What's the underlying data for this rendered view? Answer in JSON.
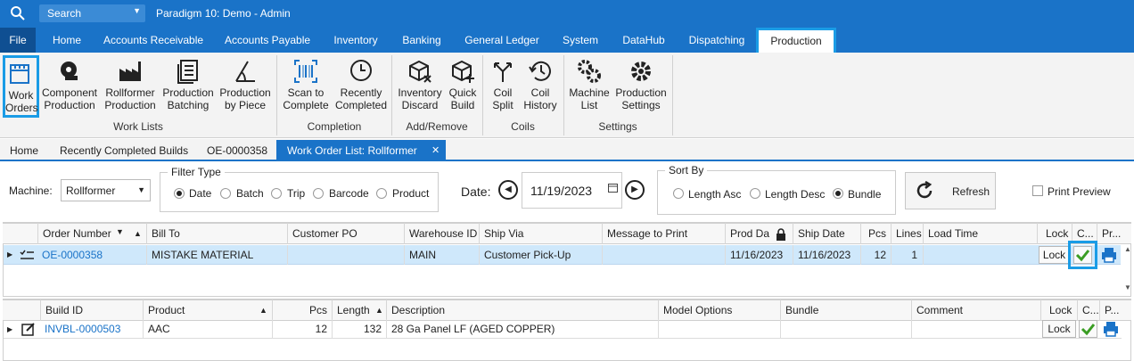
{
  "titlebar": {
    "search_placeholder": "Search",
    "app_title": "Paradigm 10: Demo - Admin"
  },
  "menu": {
    "file": "File",
    "home": "Home",
    "accounts_receivable": "Accounts Receivable",
    "accounts_payable": "Accounts Payable",
    "inventory": "Inventory",
    "banking": "Banking",
    "general_ledger": "General Ledger",
    "system": "System",
    "datahub": "DataHub",
    "dispatching": "Dispatching",
    "production": "Production"
  },
  "ribbon": {
    "work_orders": [
      "Work",
      "Orders"
    ],
    "component_production": [
      "Component",
      "Production"
    ],
    "rollformer_production": [
      "Rollformer",
      "Production"
    ],
    "production_batching": [
      "Production",
      "Batching"
    ],
    "production_by_piece": [
      "Production",
      "by Piece"
    ],
    "scan_to_complete": [
      "Scan to",
      "Complete"
    ],
    "recently_completed": [
      "Recently",
      "Completed"
    ],
    "inventory_discard": [
      "Inventory",
      "Discard"
    ],
    "quick_build": [
      "Quick",
      "Build"
    ],
    "coil_split": [
      "Coil",
      "Split"
    ],
    "coil_history": [
      "Coil",
      "History"
    ],
    "machine_list": [
      "Machine",
      "List"
    ],
    "production_settings": [
      "Production",
      "Settings"
    ],
    "groups": {
      "work_lists": "Work Lists",
      "completion": "Completion",
      "add_remove": "Add/Remove",
      "coils": "Coils",
      "settings": "Settings"
    }
  },
  "tabs": {
    "home": "Home",
    "recently_completed_builds": "Recently Completed Builds",
    "order": "OE-0000358",
    "active": "Work Order List: Rollformer",
    "close": "✕"
  },
  "filters": {
    "machine_label": "Machine:",
    "machine_value": "Rollformer",
    "filter_type_label": "Filter Type",
    "filter_types": [
      "Date",
      "Batch",
      "Trip",
      "Barcode",
      "Product"
    ],
    "filter_selected": "Date",
    "date_label": "Date:",
    "date_value": "11/19/2023",
    "sort_by_label": "Sort By",
    "sort_options": [
      "Length Asc",
      "Length Desc",
      "Bundle"
    ],
    "sort_selected": "Bundle",
    "refresh": "Refresh",
    "print_preview": "Print Preview"
  },
  "orders": {
    "headers": {
      "order_number": "Order Number",
      "bill_to": "Bill To",
      "customer_po": "Customer PO",
      "warehouse_id": "Warehouse ID",
      "ship_via": "Ship Via",
      "message": "Message to Print",
      "prod_date": "Prod Da",
      "ship_date": "Ship Date",
      "pcs": "Pcs",
      "lines": "Lines",
      "load_time": "Load Time",
      "lock": "Lock",
      "complete": "C...",
      "print": "Pr..."
    },
    "row": {
      "order_number": "OE-0000358",
      "bill_to": "MISTAKE MATERIAL",
      "customer_po": "",
      "warehouse_id": "MAIN",
      "ship_via": "Customer Pick-Up",
      "message": "",
      "prod_date": "11/16/2023",
      "ship_date": "11/16/2023",
      "pcs": "12",
      "lines": "1",
      "load_time": "",
      "lock": "Lock"
    }
  },
  "builds": {
    "headers": {
      "build_id": "Build ID",
      "product": "Product",
      "pcs": "Pcs",
      "length": "Length",
      "description": "Description",
      "model_options": "Model Options",
      "bundle": "Bundle",
      "comment": "Comment",
      "lock": "Lock",
      "complete": "C...",
      "print": "P..."
    },
    "row": {
      "build_id": "INVBL-0000503",
      "product": "AAC",
      "pcs": "12",
      "length": "132",
      "description": "28 Ga Panel LF (AGED COPPER)",
      "model_options": "",
      "bundle": "",
      "comment": "",
      "lock": "Lock"
    }
  },
  "colors": {
    "accent": "#1a73c8",
    "highlight": "#1a9ce6",
    "selected_row": "#cfe8fb",
    "check": "#3a9d23"
  }
}
